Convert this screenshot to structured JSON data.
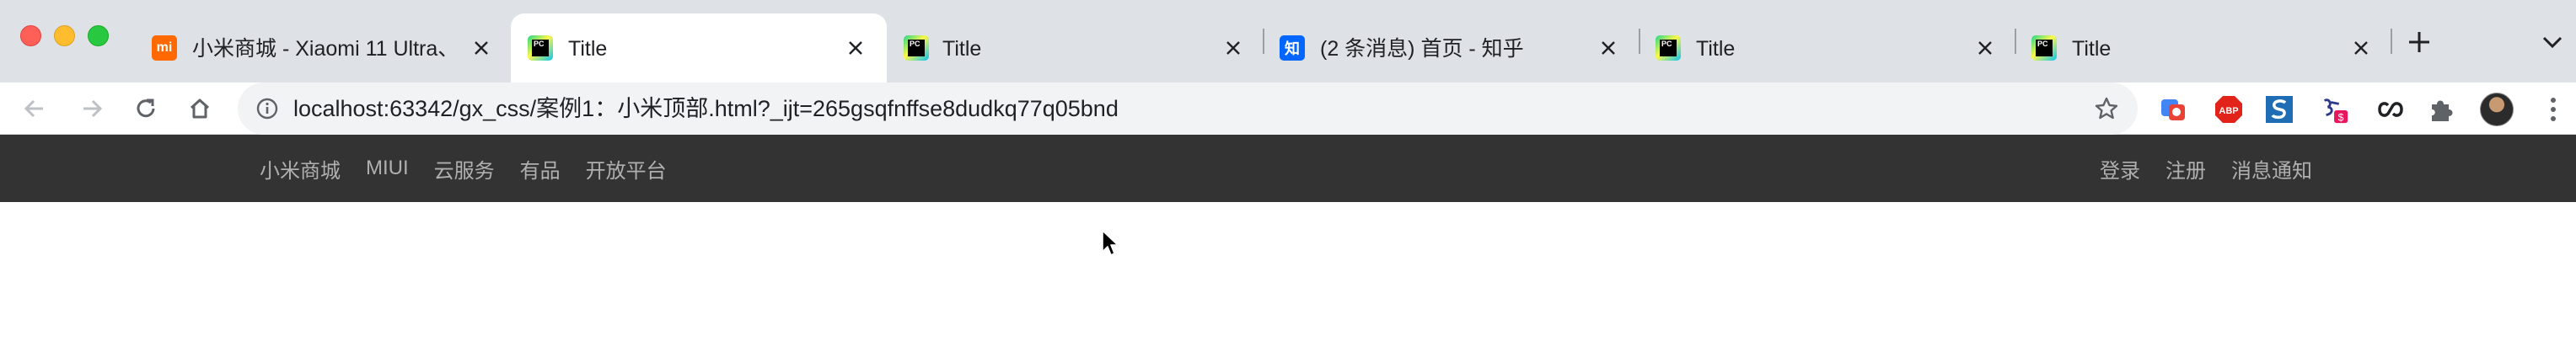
{
  "browser": {
    "tabs": [
      {
        "title": "小米商城 - Xiaomi 11 Ultra、",
        "favicon": "mi-icon",
        "active": false
      },
      {
        "title": "Title",
        "favicon": "pycharm-icon",
        "active": true
      },
      {
        "title": "Title",
        "favicon": "pycharm-icon",
        "active": false
      },
      {
        "title": "(2 条消息) 首页 - 知乎",
        "favicon": "zhihu-icon",
        "active": false
      },
      {
        "title": "Title",
        "favicon": "pycharm-icon",
        "active": false
      },
      {
        "title": "Title",
        "favicon": "pycharm-icon",
        "active": false
      }
    ],
    "favicon_text": {
      "mi": "mi",
      "pc": "PC",
      "zhi": "知"
    },
    "address": "localhost:63342/gx_css/案例1：小米顶部.html?_ijt=265gsqfnffse8dudkq77q05bnd",
    "extensions": [
      "translate-icon",
      "adblock-plus-icon",
      "s-extension-icon",
      "tampermonkey-icon",
      "link-icon",
      "puzzle-extensions-icon"
    ],
    "adblock_label": "ABP",
    "ext_badge": "$",
    "colors": {
      "tabstrip": "#dee1e6",
      "omnibox": "#f1f3f4"
    }
  },
  "site": {
    "topbar": {
      "left_links": [
        "小米商城",
        "MIUI",
        "云服务",
        "有品",
        "开放平台"
      ],
      "right_links": [
        "登录",
        "注册",
        "消息通知"
      ],
      "background": "#333333",
      "link_color": "#b0b0b0"
    }
  }
}
